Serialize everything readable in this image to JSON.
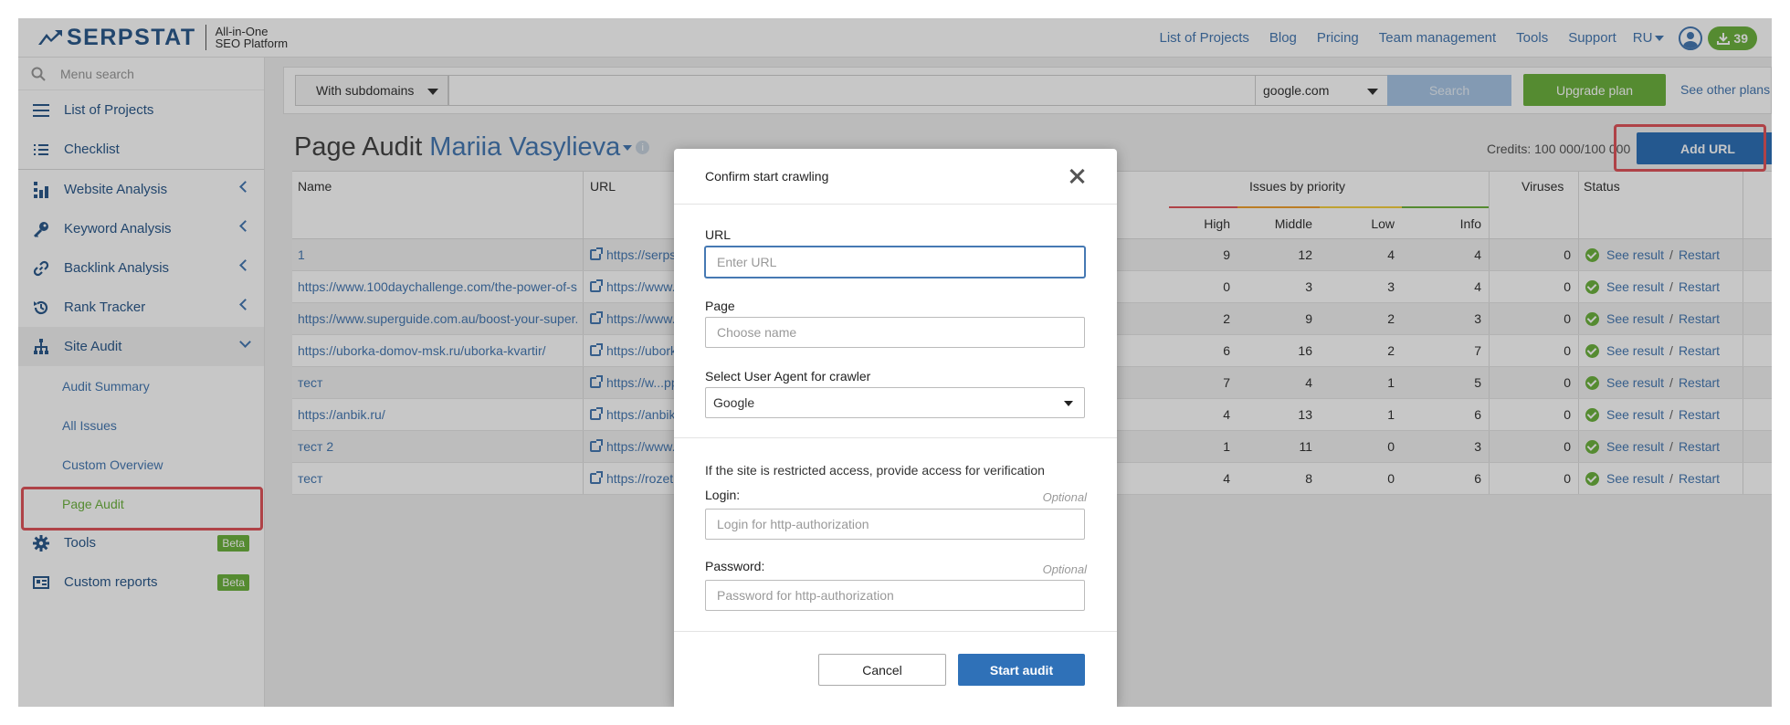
{
  "header": {
    "logo_text": "SERPSTAT",
    "logo_sub_1": "All-in-One",
    "logo_sub_2": "SEO Platform",
    "nav": [
      "List of Projects",
      "Blog",
      "Pricing",
      "Team management",
      "Tools",
      "Support"
    ],
    "lang": "RU",
    "downloads_count": "39"
  },
  "sidebar": {
    "search_placeholder": "Menu search",
    "items": [
      {
        "label": "List of Projects",
        "icon": "menu-icon"
      },
      {
        "label": "Checklist",
        "icon": "checklist-icon"
      },
      {
        "label": "Website Analysis",
        "icon": "website-analysis-icon"
      },
      {
        "label": "Keyword Analysis",
        "icon": "key-icon"
      },
      {
        "label": "Backlink Analysis",
        "icon": "link-icon"
      },
      {
        "label": "Rank Tracker",
        "icon": "history-icon"
      },
      {
        "label": "Site Audit",
        "icon": "sitemap-icon"
      }
    ],
    "site_audit_sub": [
      "Audit Summary",
      "All Issues",
      "Custom Overview",
      "Page Audit"
    ],
    "tools_label": "Tools",
    "custom_reports_label": "Custom reports",
    "beta_label": "Beta"
  },
  "searchbar": {
    "subdomains": "With subdomains",
    "engine": "google.com",
    "search_label": "Search",
    "upgrade_label": "Upgrade plan",
    "other_plans": "See other plans"
  },
  "page": {
    "title": "Page Audit",
    "project": "Mariia Vasylieva",
    "credits": "Credits: 100 000/100 000",
    "add_url": "Add URL"
  },
  "table": {
    "headers": {
      "name": "Name",
      "url": "URL",
      "issues": "Issues by priority",
      "high": "High",
      "middle": "Middle",
      "low": "Low",
      "info": "Info",
      "viruses": "Viruses",
      "status": "Status"
    },
    "see_result": "See result",
    "restart": "Restart",
    "divider": "/",
    "rows": [
      {
        "name": "1",
        "url": "https://serpsta",
        "high": "9",
        "middle": "12",
        "low": "4",
        "info": "4",
        "viruses": "0"
      },
      {
        "name": "https://www.100daychallenge.com/the-power-of-s...",
        "url": "https://www.10",
        "high": "0",
        "middle": "3",
        "low": "3",
        "info": "4",
        "viruses": "0"
      },
      {
        "name": "https://www.superguide.com.au/boost-your-super...",
        "url": "https://www.su",
        "high": "2",
        "middle": "9",
        "low": "2",
        "info": "3",
        "viruses": "0"
      },
      {
        "name": "https://uborka-domov-msk.ru/uborka-kvartir/",
        "url": "https://uborka-",
        "high": "6",
        "middle": "16",
        "low": "2",
        "info": "7",
        "viruses": "0"
      },
      {
        "name": "тест",
        "url": "https://w...pple",
        "high": "7",
        "middle": "4",
        "low": "1",
        "info": "5",
        "viruses": "0"
      },
      {
        "name": "https://anbik.ru/",
        "url": "https://anbik.ru",
        "high": "4",
        "middle": "13",
        "low": "1",
        "info": "6",
        "viruses": "0"
      },
      {
        "name": "тест 2",
        "url": "https://www.is",
        "high": "1",
        "middle": "11",
        "low": "0",
        "info": "3",
        "viruses": "0"
      },
      {
        "name": "тест",
        "url": "https://rozetka",
        "high": "4",
        "middle": "8",
        "low": "0",
        "info": "6",
        "viruses": "0"
      }
    ]
  },
  "modal": {
    "title": "Confirm start crawling",
    "url_label": "URL",
    "url_placeholder": "Enter URL",
    "page_label": "Page",
    "page_placeholder": "Choose name",
    "agent_label": "Select User Agent for crawler",
    "agent_value": "Google",
    "note": "If the site is restricted access, provide access for verification",
    "login_label": "Login:",
    "login_placeholder": "Login for http-authorization",
    "password_label": "Password:",
    "password_placeholder": "Password for http-authorization",
    "optional": "Optional",
    "cancel": "Cancel",
    "start": "Start audit"
  },
  "colors": {
    "accent_blue": "#2f71b8",
    "link_blue": "#4679b3",
    "green": "#6db33f",
    "highlight_red": "#e0555b"
  }
}
